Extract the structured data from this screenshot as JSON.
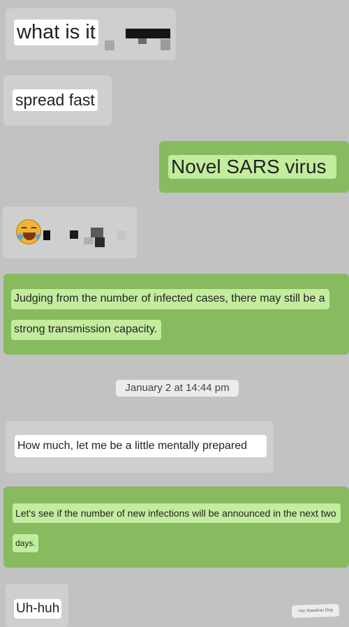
{
  "messages": [
    {
      "side": "incoming",
      "text": "what is it"
    },
    {
      "side": "incoming",
      "text": "spread fast"
    },
    {
      "side": "outgoing",
      "text": "Novel SARS virus"
    },
    {
      "side": "incoming",
      "text": "",
      "emoji": "laughing-crying-emoji",
      "redacted": true
    },
    {
      "side": "outgoing",
      "lines": [
        "Judging from the number of infected cases, there may still be a",
        "strong transmission capacity."
      ]
    },
    {
      "side": "incoming",
      "text": "How much, let me be a little mentally prepared"
    },
    {
      "side": "outgoing",
      "lines": [
        "Let's see if the number of new infections will be announced in the next two",
        "days."
      ]
    },
    {
      "side": "incoming",
      "text": "Uh-huh"
    }
  ],
  "timestamp": "January 2 at 14:44 pm",
  "watermark": "Yan Xiaoshan Dog",
  "colors": {
    "background": "#c2c2c2",
    "incoming_bubble": "#cfcfcf",
    "outgoing_bubble": "#88ba60",
    "outgoing_highlight": "#c3ec9e",
    "incoming_highlight": "#ffffff"
  }
}
